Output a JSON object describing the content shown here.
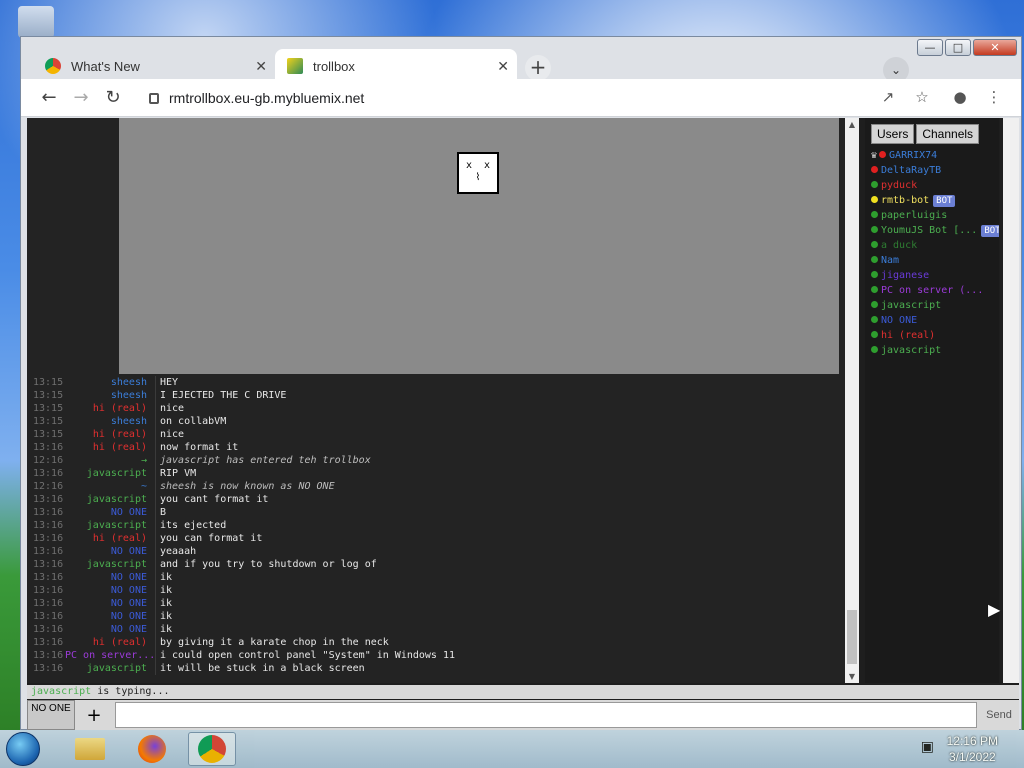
{
  "browser": {
    "tabs": [
      {
        "title": "What's New",
        "active": false
      },
      {
        "title": "trollbox",
        "active": true
      }
    ],
    "url": "rmtrollbox.eu-gb.mybluemix.net"
  },
  "vm_screen": {
    "icon": "sad-computer-icon"
  },
  "messages": [
    {
      "time": "13:15",
      "nick": "sheesh",
      "color": "#3b7dd8",
      "text": "HEY"
    },
    {
      "time": "13:15",
      "nick": "sheesh",
      "color": "#3b7dd8",
      "text": "I EJECTED THE C DRIVE"
    },
    {
      "time": "13:15",
      "nick": "hi (real)",
      "color": "#e03030",
      "text": "nice"
    },
    {
      "time": "13:15",
      "nick": "sheesh",
      "color": "#3b7dd8",
      "text": "on collabVM"
    },
    {
      "time": "13:15",
      "nick": "hi (real)",
      "color": "#e03030",
      "text": "nice"
    },
    {
      "time": "13:16",
      "nick": "hi (real)",
      "color": "#e03030",
      "text": "now format it"
    },
    {
      "time": "12:16",
      "nick": "→",
      "color": "#4caf50",
      "text": "javascript has entered teh trollbox",
      "system": true
    },
    {
      "time": "13:16",
      "nick": "javascript",
      "color": "#4caf50",
      "text": "RIP VM"
    },
    {
      "time": "12:16",
      "nick": "~",
      "color": "#3b7dd8",
      "text": "sheesh is now known as NO ONE",
      "system": true
    },
    {
      "time": "13:16",
      "nick": "javascript",
      "color": "#4caf50",
      "text": "you cant format it"
    },
    {
      "time": "13:16",
      "nick": "NO ONE",
      "color": "#3b5bd8",
      "text": "B"
    },
    {
      "time": "13:16",
      "nick": "javascript",
      "color": "#4caf50",
      "text": "its ejected"
    },
    {
      "time": "13:16",
      "nick": "hi (real)",
      "color": "#e03030",
      "text": "you can format it"
    },
    {
      "time": "13:16",
      "nick": "NO ONE",
      "color": "#3b5bd8",
      "text": "yeaaah"
    },
    {
      "time": "13:16",
      "nick": "javascript",
      "color": "#4caf50",
      "text": "and if you try to shutdown or log of"
    },
    {
      "time": "13:16",
      "nick": "NO ONE",
      "color": "#3b5bd8",
      "text": "ik"
    },
    {
      "time": "13:16",
      "nick": "NO ONE",
      "color": "#3b5bd8",
      "text": "ik"
    },
    {
      "time": "13:16",
      "nick": "NO ONE",
      "color": "#3b5bd8",
      "text": "ik"
    },
    {
      "time": "13:16",
      "nick": "NO ONE",
      "color": "#3b5bd8",
      "text": "ik"
    },
    {
      "time": "13:16",
      "nick": "NO ONE",
      "color": "#3b5bd8",
      "text": "ik"
    },
    {
      "time": "13:16",
      "nick": "hi (real)",
      "color": "#e03030",
      "text": "by giving it a karate chop in the neck"
    },
    {
      "time": "13:16",
      "nick": "PC on server...",
      "color": "#9b3bd8",
      "text": "i could open control panel \"System\" in Windows 11"
    },
    {
      "time": "13:16",
      "nick": "javascript",
      "color": "#4caf50",
      "text": "it will be stuck in a black screen"
    }
  ],
  "sidebar": {
    "tabs": [
      "Users",
      "Channels"
    ],
    "users": [
      {
        "name": "GARRIX74",
        "color": "#3b7dd8",
        "dot": "#e02020",
        "crown": true
      },
      {
        "name": "DeltaRayTB",
        "color": "#3b7dd8",
        "dot": "#e02020"
      },
      {
        "name": "pyduck",
        "color": "#e03030",
        "dot": "#2e9e2e"
      },
      {
        "name": "rmtb-bot",
        "color": "#f0e060",
        "dot": "#f0e020",
        "bot": "BOT"
      },
      {
        "name": "paperluigis",
        "color": "#4caf50",
        "dot": "#2e9e2e"
      },
      {
        "name": "YoumuJS Bot [...",
        "color": "#4caf50",
        "dot": "#2e9e2e",
        "bot": "BOT"
      },
      {
        "name": "a duck",
        "color": "#2e7d32",
        "dot": "#2e9e2e"
      },
      {
        "name": "Nam",
        "color": "#3b7dd8",
        "dot": "#2e9e2e"
      },
      {
        "name": "jiganese",
        "color": "#6a3bd8",
        "dot": "#2e9e2e"
      },
      {
        "name": "PC on server (...",
        "color": "#9b3bd8",
        "dot": "#2e9e2e"
      },
      {
        "name": "javascript",
        "color": "#4caf50",
        "dot": "#2e9e2e"
      },
      {
        "name": "NO ONE",
        "color": "#3b5bd8",
        "dot": "#2e9e2e"
      },
      {
        "name": "hi (real)",
        "color": "#e03030",
        "dot": "#2e9e2e"
      },
      {
        "name": "javascript",
        "color": "#4caf50",
        "dot": "#2e9e2e"
      }
    ]
  },
  "typing": {
    "who": "javascript",
    "label": "is typing..."
  },
  "input": {
    "nick_label": "NO ONE",
    "plus_label": "+",
    "send_label": "Send"
  },
  "taskbar": {
    "time": "12:16 PM",
    "date": "3/1/2022"
  }
}
